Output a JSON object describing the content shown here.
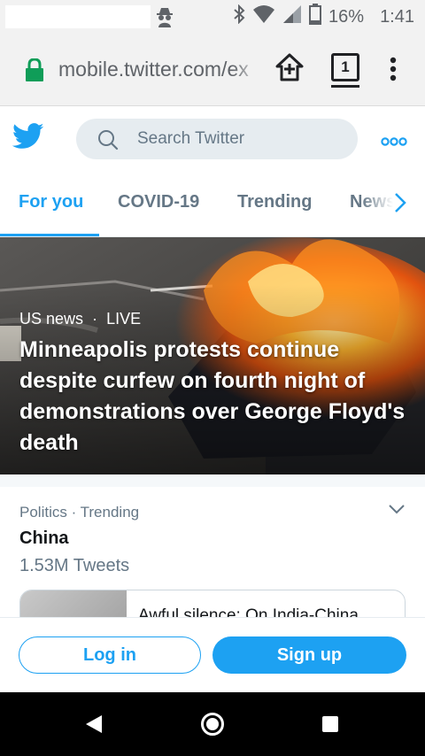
{
  "status_bar": {
    "battery": "16%",
    "time": "1:41",
    "icons": [
      "incognito-icon",
      "bluetooth-icon",
      "wifi-icon",
      "signal-icon",
      "battery-icon"
    ]
  },
  "browser": {
    "url": "mobile.twitter.com/ex",
    "tab_count": "1",
    "icons": [
      "lock-icon",
      "add-to-home-icon",
      "tabs-icon",
      "overflow-menu-icon"
    ]
  },
  "header": {
    "search_placeholder": "Search Twitter",
    "icons": [
      "twitter-bird-icon",
      "search-icon",
      "more-icon"
    ]
  },
  "tabs": [
    {
      "label": "For you",
      "active": true
    },
    {
      "label": "COVID-19",
      "active": false
    },
    {
      "label": "Trending",
      "active": false
    },
    {
      "label": "News",
      "active": false
    }
  ],
  "hero": {
    "category": "US news",
    "separator": "·",
    "live_label": "LIVE",
    "headline": "Minneapolis protests continue despite curfew on fourth night of demonstrations over George Floyd's death"
  },
  "trend": {
    "context": "Politics · Trending",
    "title": "China",
    "count": "1.53M Tweets",
    "article_title": "Awful silence: On India-China"
  },
  "auth": {
    "login_label": "Log in",
    "signup_label": "Sign up"
  },
  "colors": {
    "twitter_blue": "#1da1f2",
    "secondary_text": "#657786",
    "lock_green": "#0f9d58"
  }
}
